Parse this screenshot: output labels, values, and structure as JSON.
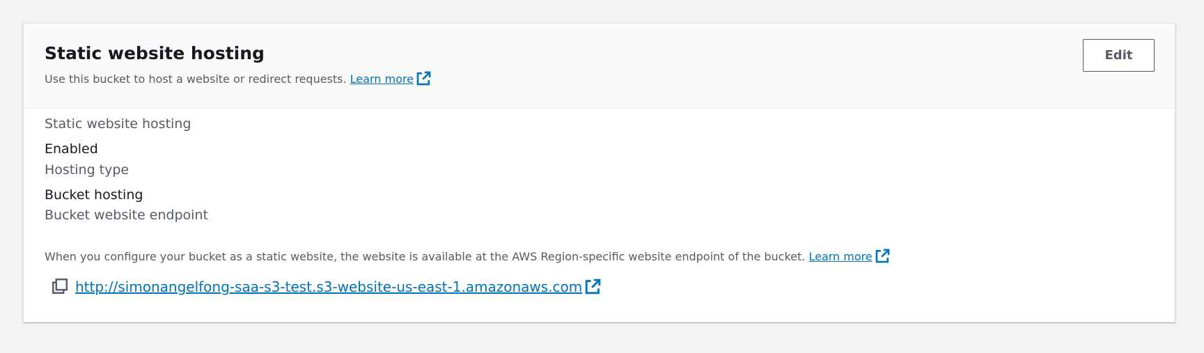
{
  "section": {
    "title": "Static website hosting",
    "description": "Use this bucket to host a website or redirect requests.",
    "learn_more": "Learn more",
    "edit_label": "Edit"
  },
  "fields": {
    "hosting_label": "Static website hosting",
    "hosting_value": "Enabled",
    "type_label": "Hosting type",
    "type_value": "Bucket hosting",
    "endpoint_label": "Bucket website endpoint",
    "endpoint_note": "When you configure your bucket as a static website, the website is available at the AWS Region-specific website endpoint of the bucket.",
    "endpoint_learn_more": "Learn more",
    "endpoint_url": "http://simonangelfong-saa-s3-test.s3-website-us-east-1.amazonaws.com"
  },
  "icons": {
    "external_link": "external-link-icon",
    "copy": "copy-icon"
  },
  "colors": {
    "link": "#0073bb",
    "page_background": "#f2f3f3",
    "header_background": "#fafafa"
  }
}
